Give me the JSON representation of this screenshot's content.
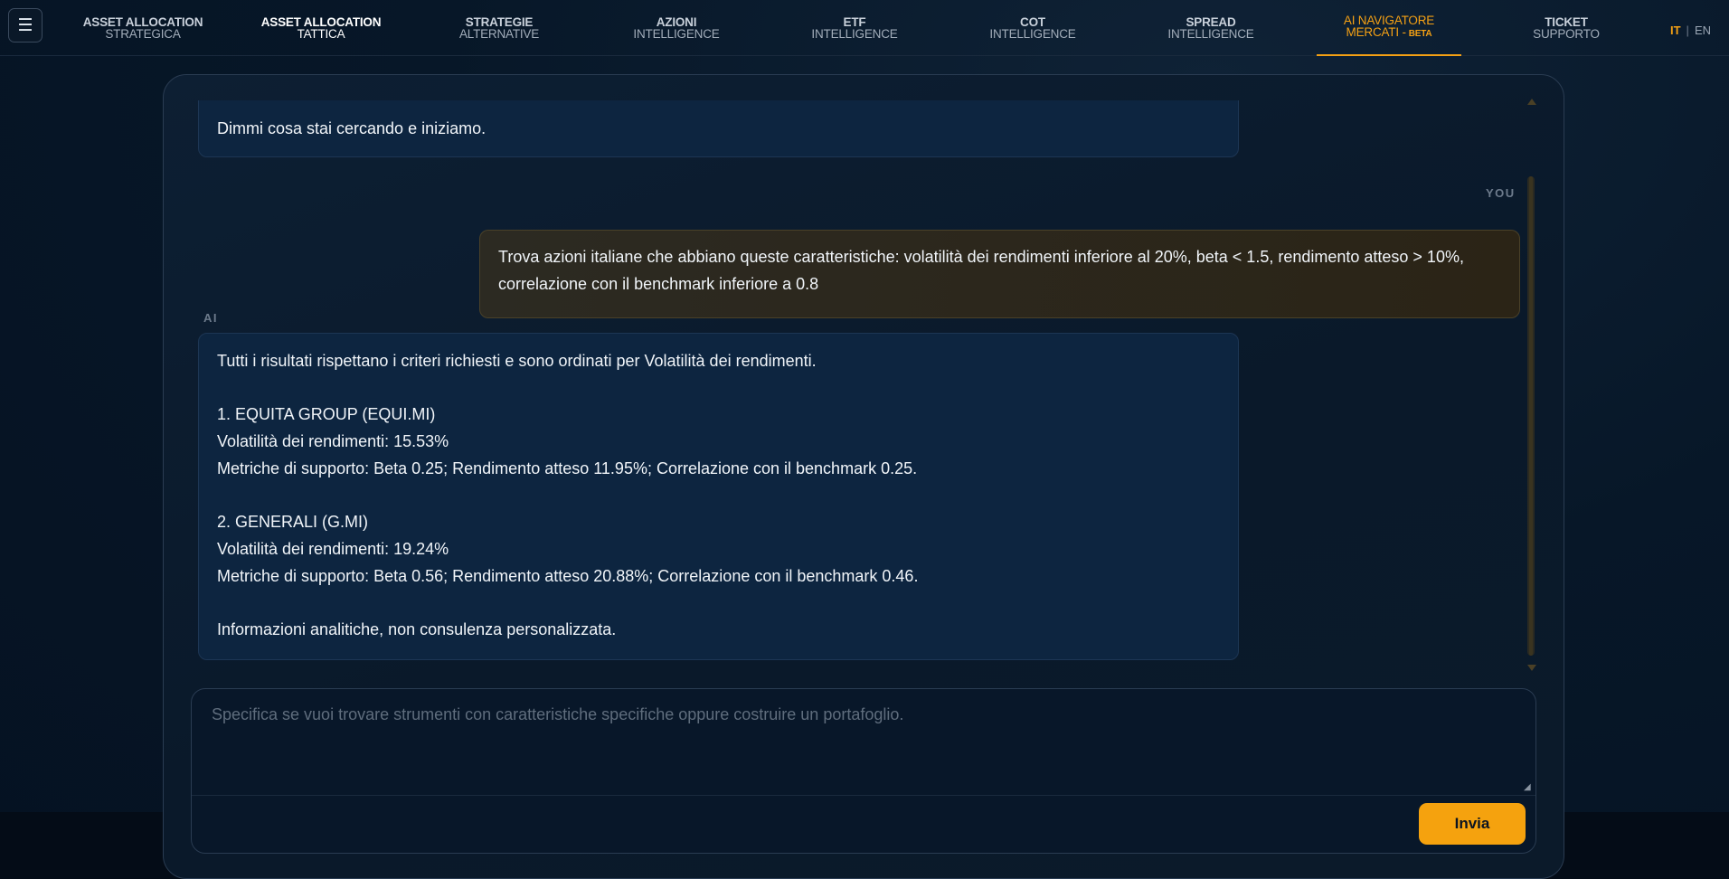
{
  "nav": {
    "menu_icon": "☰",
    "items": [
      {
        "line1": "ASSET ALLOCATION",
        "line2": "STRATEGICA"
      },
      {
        "line1": "ASSET ALLOCATION",
        "line2": "TATTICA"
      },
      {
        "line1": "STRATEGIE",
        "line2": "ALTERNATIVE"
      },
      {
        "line1": "AZIONI",
        "line2": "INTELLIGENCE"
      },
      {
        "line1": "ETF",
        "line2": "INTELLIGENCE"
      },
      {
        "line1": "COT",
        "line2": "INTELLIGENCE"
      },
      {
        "line1": "SPREAD",
        "line2": "INTELLIGENCE"
      },
      {
        "line1": "AI NAVIGATORE",
        "line2": "MERCATI -",
        "badge": "BETA"
      },
      {
        "line1": "TICKET",
        "line2": "SUPPORTO"
      }
    ],
    "lang": {
      "it": "IT",
      "sep": "|",
      "en": "EN"
    }
  },
  "chat": {
    "ai_intro_text": "Dimmi cosa stai cercando e iniziamo.",
    "you_label": "YOU",
    "user_message": "Trova azioni italiane che abbiano queste caratteristiche: volatilità dei rendimenti inferiore al 20%, beta < 1.5, rendimento atteso > 10%, correlazione con il benchmark inferiore a 0.8",
    "ai_label": "AI",
    "ai_response": "Tutti i risultati rispettano i criteri richiesti e sono ordinati per Volatilità dei rendimenti.\n\n1. EQUITA GROUP (EQUI.MI)\nVolatilità dei rendimenti: 15.53%\nMetriche di supporto: Beta 0.25; Rendimento atteso 11.95%; Correlazione con il benchmark 0.25.\n\n2. GENERALI (G.MI)\nVolatilità dei rendimenti: 19.24%\nMetriche di supporto: Beta 0.56; Rendimento atteso 20.88%; Correlazione con il benchmark 0.46.\n\nInformazioni analitiche, non consulenza personalizzata."
  },
  "composer": {
    "placeholder": "Specifica se vuoi trovare strumenti con caratteristiche specifiche oppure costruire un portafoglio.",
    "value": "",
    "send_label": "Invia"
  },
  "colors": {
    "accent": "#f4a014",
    "background": "#061425",
    "ai_bubble": "#0d2540",
    "user_bubble": "#2b2416"
  },
  "icons": {
    "menu": "hamburger-menu-icon",
    "scroll_up": "triangle-up-icon",
    "scroll_down": "triangle-down-icon"
  }
}
